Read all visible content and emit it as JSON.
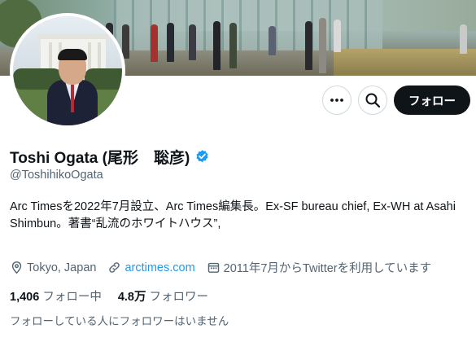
{
  "profile": {
    "display_name": "Toshi Ogata (尾形　聡彦)",
    "handle": "@ToshihikoOgata",
    "bio_line1": "Arc Timesを2022年7月設立、Arc Times編集長。Ex-SF bureau chief, Ex-WH at Asahi",
    "bio_line2": "Shimbun。著書“乱流のホワイトハウス”,",
    "location": "Tokyo, Japan",
    "website": "arctimes.com",
    "joined": "2011年7月からTwitterを利用しています",
    "following_count": "1,406",
    "following_label": "フォロー中",
    "followers_count": "4.8万",
    "followers_label": "フォロワー",
    "followers_you_know": "フォローしている人にフォロワーはいません"
  },
  "actions": {
    "more_icon": "more-horizontal-icon",
    "search_icon": "search-icon",
    "follow_label": "フォロー"
  },
  "colors": {
    "accent": "#1d9bf0",
    "text_primary": "#0f1419",
    "text_secondary": "#536471",
    "follow_button": "#0f1419"
  }
}
